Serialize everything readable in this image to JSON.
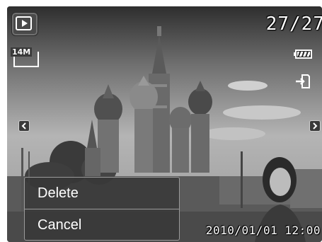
{
  "playback": {
    "mode_icon": "play-icon",
    "counter": "27/27",
    "resolution_label": "14M",
    "battery_icon": "battery-full-icon",
    "transfer_icon": "card-transfer-icon",
    "nav_left_icon": "chevron-left-icon",
    "nav_right_icon": "chevron-right-icon",
    "timestamp": "2010/01/01  12:00"
  },
  "menu": {
    "items": [
      {
        "label": "Delete"
      },
      {
        "label": "Cancel"
      }
    ]
  },
  "colors": {
    "text": "#ffffff",
    "menu_bg": "#373737",
    "menu_border": "#9a9a9a"
  }
}
